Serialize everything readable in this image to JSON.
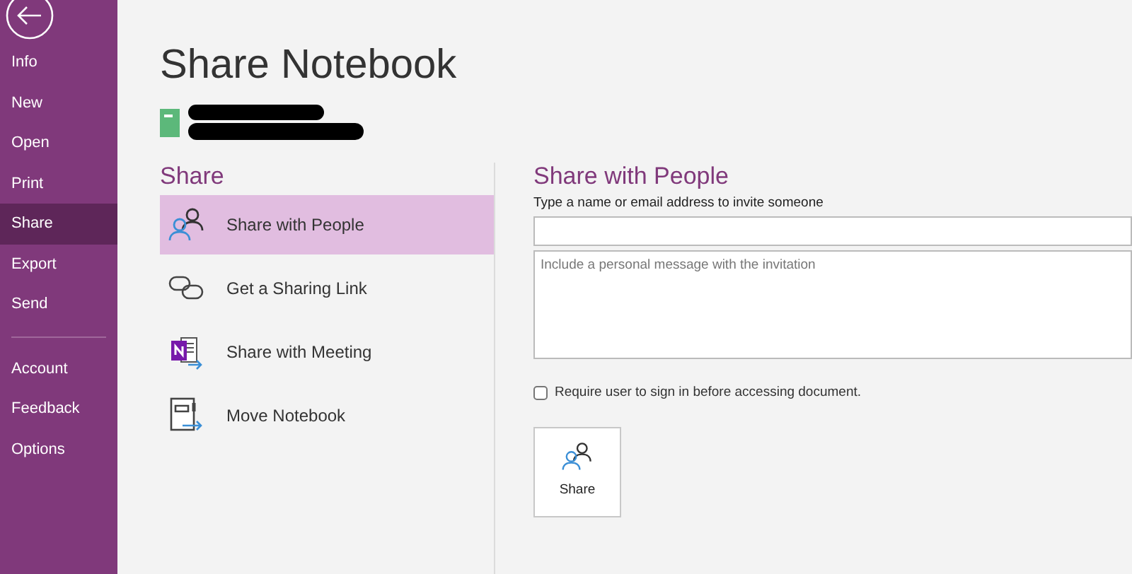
{
  "sidebar": {
    "items": [
      {
        "label": "Info",
        "selected": false
      },
      {
        "label": "New",
        "selected": false
      },
      {
        "label": "Open",
        "selected": false
      },
      {
        "label": "Print",
        "selected": false
      },
      {
        "label": "Share",
        "selected": true
      },
      {
        "label": "Export",
        "selected": false
      },
      {
        "label": "Send",
        "selected": false
      }
    ],
    "bottom_items": [
      {
        "label": "Account",
        "selected": false
      },
      {
        "label": "Feedback",
        "selected": false
      },
      {
        "label": "Options",
        "selected": false
      }
    ]
  },
  "title": "Share Notebook",
  "share_section": {
    "heading": "Share",
    "options": [
      {
        "label": "Share with People",
        "kind": "people",
        "selected": true
      },
      {
        "label": "Get a Sharing Link",
        "kind": "link",
        "selected": false
      },
      {
        "label": "Share with Meeting",
        "kind": "meeting",
        "selected": false
      },
      {
        "label": "Move Notebook",
        "kind": "move",
        "selected": false
      }
    ]
  },
  "panel": {
    "heading": "Share with People",
    "invite_label": "Type a name or email address to invite someone",
    "message": {
      "placeholder": "Include a personal message with the invitation"
    },
    "require_sign_in": {
      "label": "Require user to sign in before accessing document.",
      "checked": false
    },
    "share_button": "Share"
  }
}
